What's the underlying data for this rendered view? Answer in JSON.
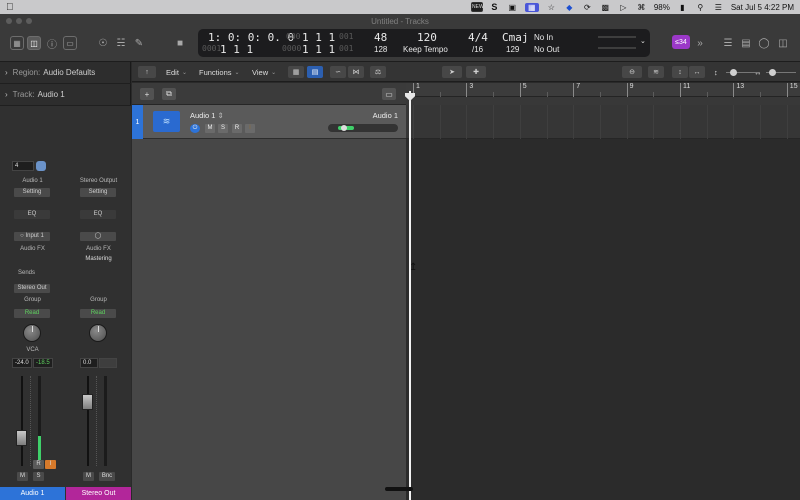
{
  "menubar": {
    "icons": [
      "apple-icon",
      "airplay-icon",
      "s-app-icon",
      "screen-icon",
      "star-icon",
      "box-icon",
      "dropbox-icon",
      "sync-icon",
      "screen-mirror-icon",
      "play-icon",
      "wifi-icon",
      "search-icon",
      "control-center-icon"
    ],
    "battery": "98%",
    "datetime": "Sat Jul 5  4:22 PM"
  },
  "window": {
    "title": "Untitled - Tracks"
  },
  "lcd": {
    "pos_smpte": "1:  0:  0:  0.  0",
    "pos_bars": "1   1   1   1",
    "pos_bars_prefix": "0001",
    "pos_bars2": "1   1   1",
    "end_bars": "5   1   1   1",
    "end_bars_prefix": "0000",
    "end_bars_tail": "001",
    "bars_a": "1   1   1",
    "bars_b": "1   1   1",
    "bar_a_tail": "001",
    "bar_b_tail": "001",
    "top_value_48": "48",
    "bottom_value_128": "128",
    "tempo": "120",
    "tempo_label": "Keep Tempo",
    "signature": "4/4",
    "division": "/16",
    "key": "Cmaj",
    "key_sub": "129",
    "in": "No In",
    "out": "No Out"
  },
  "toolbar": {
    "badge": "≤34"
  },
  "inspector": {
    "region_label": "Region:",
    "region_value": "Audio Defaults",
    "track_label": "Track:",
    "track_value": "Audio 1"
  },
  "strip1": {
    "num": "4",
    "name": "Audio 1",
    "setting": "Setting",
    "eq": "EQ",
    "input": "Input 1",
    "fx": "Audio FX",
    "sends": "Sends",
    "output": "Stereo Out",
    "group": "Group",
    "auto": "Read",
    "vca": "VCA",
    "vol": "-24.0",
    "peak": "-18.5",
    "rec": "R",
    "inp": "I",
    "mute": "M",
    "solo": "S",
    "footer": "Audio 1"
  },
  "strip2": {
    "name": "Stereo Output",
    "setting": "Setting",
    "eq": "EQ",
    "fx": "Audio FX",
    "fx2": "Mastering",
    "group": "Group",
    "auto": "Read",
    "vol": "0.0",
    "mute": "M",
    "bnc": "Bnc",
    "footer": "Stereo Out"
  },
  "tracks_toolbar": {
    "edit": "Edit",
    "functions": "Functions",
    "view": "View"
  },
  "track": {
    "number": "1",
    "name": "Audio 1",
    "right_name": "Audio 1",
    "mute": "M",
    "solo": "S",
    "rec": "R",
    "volume_fraction": 0.3
  },
  "ruler": {
    "bars": [
      "1",
      "3",
      "5",
      "7",
      "9",
      "11",
      "13",
      "15"
    ]
  },
  "colors": {
    "accent": "#2d73d8",
    "stereo_out": "#b2269a",
    "badge": "#9b38c8"
  }
}
